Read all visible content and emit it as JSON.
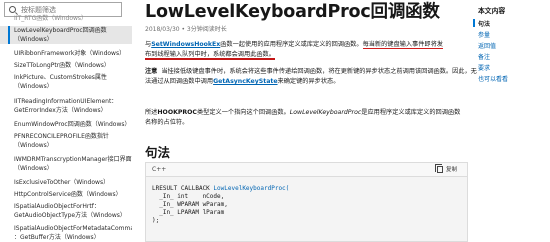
{
  "sidebar": {
    "search_placeholder": "按标题筛选",
    "items": [
      {
        "lines": [
          "IIT_RTG函数（Windows）"
        ]
      },
      {
        "lines": [
          "LowLevelKeyboardProc回调函数",
          "（Windows）"
        ]
      },
      {
        "lines": [
          "UIRibbonFramework对象（Windows）"
        ]
      },
      {
        "lines": [
          "SizeTToLongPtr函数（Windows）"
        ]
      },
      {
        "lines": [
          "InkPicture、CustomStrokes属性",
          "（Windows）"
        ]
      },
      {
        "lines": [
          "IITReadingInformationUIElement：",
          "GetErrorIndex方法（Windows）"
        ]
      },
      {
        "lines": [
          "EnumWindowProc回调函数（Windows）"
        ]
      },
      {
        "lines": [
          "PFNRECONCILEPROFILE函数指针",
          "（Windows）"
        ]
      },
      {
        "lines": [
          "IWMDRMTranscryptionManager接口界面",
          "（Windows）"
        ]
      },
      {
        "lines": [
          "IsExclusiveToOther（Windows）"
        ]
      },
      {
        "lines": [
          "HttpControlService函数（Windows）"
        ]
      },
      {
        "lines": [
          "ISpatialAudioObjectForHrtf：",
          "GetAudioObjectType方法（Windows）"
        ]
      },
      {
        "lines": [
          "ISpatialAudioObjectForMetadataCommands",
          "：GetBuffer方法（Windows）"
        ]
      }
    ]
  },
  "article": {
    "title": "LowLevelKeyboardProc回调函数",
    "meta": "2018/03/30 • 3分钟阅读时长",
    "intro": {
      "prefix": "与",
      "link": "SetWindowsHookEx",
      "mid": "函数一起使用的应用程序定义或库定义的回调函数。",
      "underlined_1": "每当新的键盘输入事件即将发",
      "underlined_2": "布到线程输入队列中时，系统都会调用此函数。"
    },
    "note": {
      "label": "注意",
      "line1": "当挂接低级键盘事件时，系统会将这些事件传递给回调函数，将在更新键的异步状态之前调用该回调函数。因此，无",
      "line2_prefix": "法通过从回调函数中调用",
      "line2_link": "GetAsyncKeyState",
      "line2_suffix": "来确定键的异步状态。"
    },
    "hookproc": {
      "bold": "HOOKPROC",
      "text1": "类型定义一个指向这个回调函数。",
      "italic": "LowLevelKeyboardProc",
      "text2": "是应用程序定义或库定义的回调函数",
      "line2": "名称的占位符。"
    },
    "syntax_heading": "句法",
    "code": {
      "lang": "C++",
      "copy_label": "复制",
      "line1_prefix": "LRESULT CALLBACK ",
      "line1_fn": "LowLevelKeyboardProc(",
      "line2": "  _In_ int    nCode,",
      "line3": "  _In_ WPARAM wParam,",
      "line4": "  _In_ LPARAM lParam",
      "line5": ");"
    }
  },
  "toc": {
    "title": "本文内容",
    "items": [
      "句法",
      "参量",
      "返回值",
      "备注",
      "要求",
      "也可以看看"
    ],
    "active_index": 0
  },
  "colors": {
    "link": "#0065b3",
    "accent": "#0078d4",
    "annotation_underline": "#c41616"
  }
}
